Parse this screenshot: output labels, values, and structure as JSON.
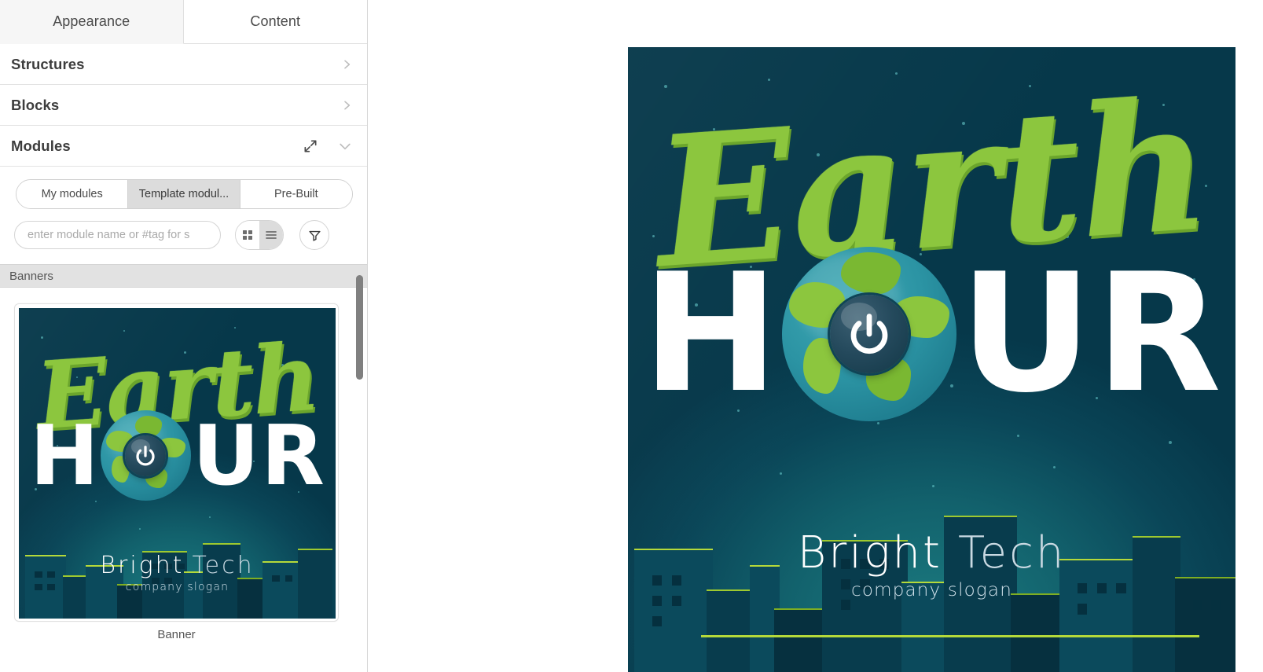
{
  "sidebar": {
    "tabs": [
      {
        "label": "Appearance",
        "active": true
      },
      {
        "label": "Content",
        "active": false
      }
    ],
    "sections": [
      {
        "label": "Structures",
        "state": "collapsed"
      },
      {
        "label": "Blocks",
        "state": "collapsed"
      },
      {
        "label": "Modules",
        "state": "expanded"
      }
    ],
    "module_tabs": [
      {
        "label": "My modules",
        "active": false
      },
      {
        "label": "Template modul...",
        "active": true
      },
      {
        "label": "Pre-Built",
        "active": false
      }
    ],
    "search": {
      "placeholder": "enter module name or #tag for s",
      "value": ""
    },
    "view_toggle": {
      "grid_icon": "grid-view-icon",
      "list_icon": "list-view-icon",
      "active": "list"
    },
    "filter_icon": "funnel-filter-icon",
    "group_header": "Banners",
    "cards": [
      {
        "caption": "Banner"
      }
    ]
  },
  "banner": {
    "script_word": "Earth",
    "headline_letters": [
      "H",
      "O",
      "U",
      "R"
    ],
    "brand_primary": "Bright",
    "brand_secondary": "Tech",
    "slogan": "company slogan",
    "colors": {
      "background_deep": "#06384a",
      "background_mid": "#0f5b68",
      "background_glow": "#1b7b80",
      "script_green": "#8cc63e",
      "script_green_shadow": "#6ba52c",
      "accent_lime": "#b5d93a",
      "headline_white": "#ffffff",
      "globe_ocean": "#2b93a3",
      "globe_land": "#8cc63e",
      "power_button": "#17414f",
      "building_dark": "#0b4a5c"
    },
    "power_icon": "power-button-icon",
    "globe_icon": "globe-earth-icon"
  },
  "ui_colors": {
    "panel_border": "#d6d6d6",
    "tab_active_bg": "#f6f6f6",
    "segment_active_bg": "#dcdcdc",
    "group_header_bg": "#e2e2e2",
    "scrollbar_thumb": "#808080"
  }
}
